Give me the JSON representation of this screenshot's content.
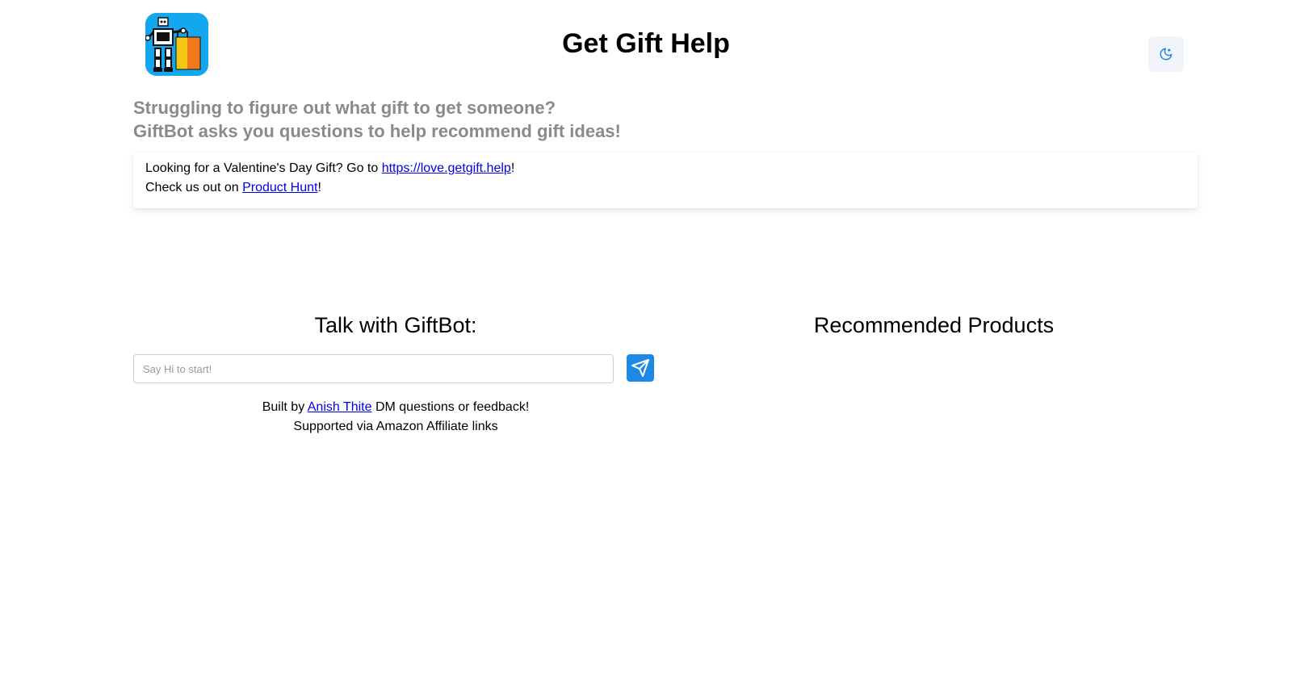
{
  "header": {
    "logo_alt": "GiftBot robot with shopping bag logo",
    "logo_icon": "robot-shopping-bag-icon",
    "title": "Get Gift Help",
    "theme_toggle_icon": "moon-icon"
  },
  "tagline": {
    "line1": "Struggling to figure out what gift to get someone?",
    "line2": "GiftBot asks you questions to help recommend gift ideas!"
  },
  "announcement": {
    "line1_prefix": "Looking for a Valentine's Day Gift? Go to ",
    "line1_link": "https://love.getgift.help",
    "line1_suffix": "!",
    "line2_prefix": "Check us out on ",
    "line2_link": "Product Hunt",
    "line2_suffix": "!"
  },
  "chat": {
    "heading": "Talk with GiftBot:",
    "input_placeholder": "Say Hi to start!",
    "input_value": "",
    "send_icon": "send-icon"
  },
  "recommendations": {
    "heading": "Recommended Products"
  },
  "footer": {
    "built_by_prefix": "Built by ",
    "author_link": "Anish Thite",
    "built_by_suffix": " DM questions or feedback!",
    "support_line": "Supported via Amazon Affiliate links"
  },
  "colors": {
    "logo_background": "#12a7ee",
    "accent_blue": "#1e88e5",
    "link": "#0000ee",
    "tagline_gray": "#8a8a8a",
    "toggle_background": "#f1f5f9"
  }
}
